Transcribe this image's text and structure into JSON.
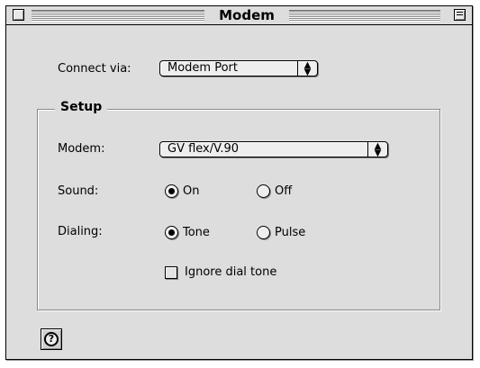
{
  "window": {
    "title": "Modem"
  },
  "connect": {
    "label": "Connect via:",
    "value": "Modem Port"
  },
  "setup": {
    "title": "Setup",
    "modem": {
      "label": "Modem:",
      "value": "GV flex/V.90"
    },
    "sound": {
      "label": "Sound:",
      "options": [
        "On",
        "Off"
      ],
      "selected": "On"
    },
    "dialing": {
      "label": "Dialing:",
      "options": [
        "Tone",
        "Pulse"
      ],
      "selected": "Tone"
    },
    "ignore_dial_tone": {
      "label": "Ignore dial tone",
      "checked": false
    }
  },
  "help": {
    "glyph": "?"
  },
  "icons": {
    "close": "close-box-icon",
    "collapse": "collapse-box-icon",
    "popup_arrows": "up-down-arrows-icon",
    "help": "help-icon"
  }
}
